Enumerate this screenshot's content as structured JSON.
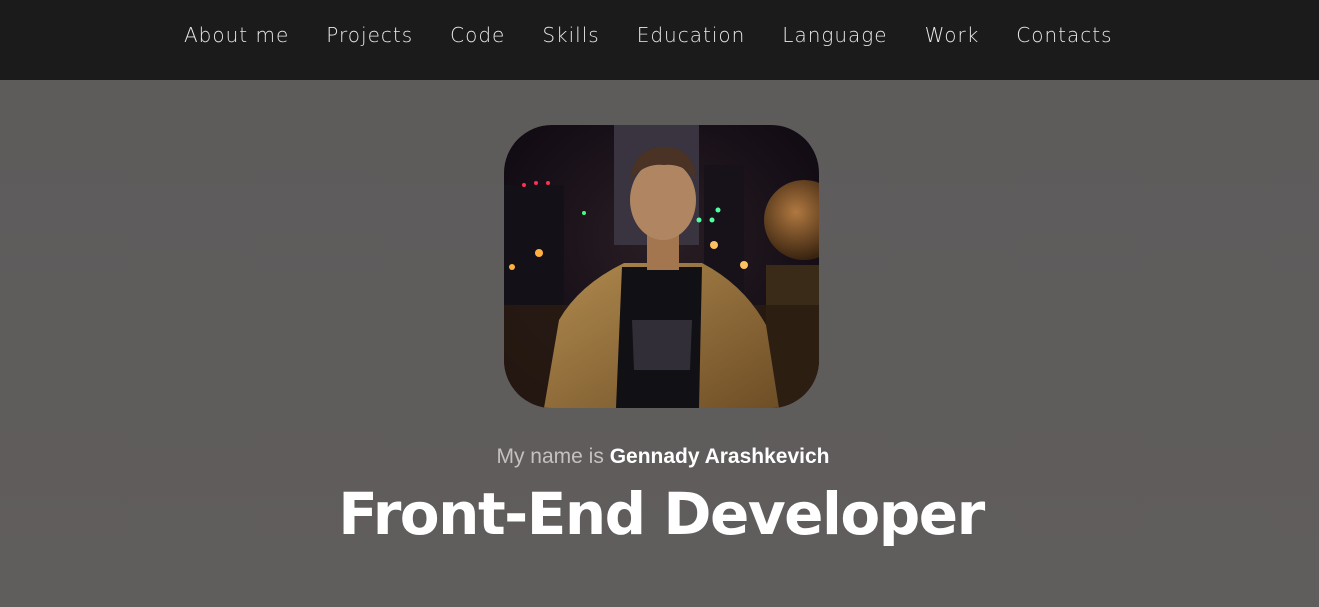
{
  "nav": {
    "items": [
      {
        "label": "About me"
      },
      {
        "label": "Projects"
      },
      {
        "label": "Code"
      },
      {
        "label": "Skills"
      },
      {
        "label": "Education"
      },
      {
        "label": "Language"
      },
      {
        "label": "Work"
      },
      {
        "label": "Contacts"
      }
    ]
  },
  "hero": {
    "intro_prefix": "My name is",
    "name": "Gennady Arashkevich",
    "headline": "Front-End Developer"
  },
  "colors": {
    "nav_background": "#1c1b1b",
    "hero_background": "#5e5b5b",
    "nav_text": "#e8e8e8",
    "headline_text": "#ffffff"
  }
}
